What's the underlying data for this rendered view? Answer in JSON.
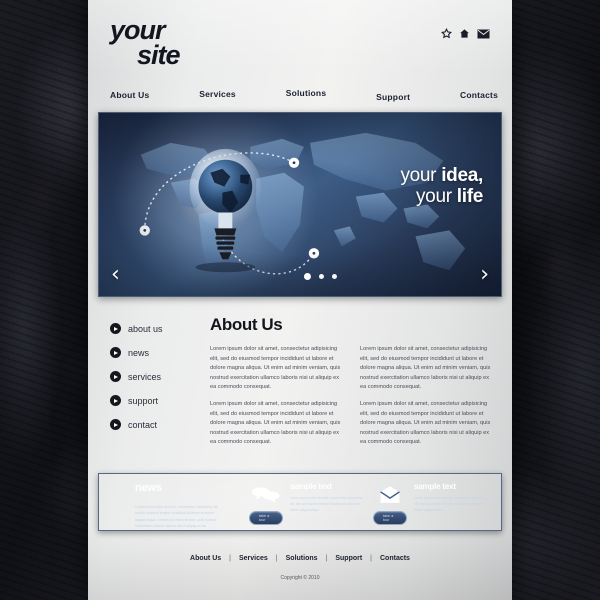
{
  "branding": {
    "logo_line1": "your",
    "logo_line2": "site"
  },
  "header": {
    "utility_icons": [
      {
        "name": "star-icon",
        "glyph": "star"
      },
      {
        "name": "home-icon",
        "glyph": "home"
      },
      {
        "name": "mail-icon",
        "glyph": "envelope"
      }
    ],
    "nav": [
      {
        "label": "About Us"
      },
      {
        "label": "Services"
      },
      {
        "label": "Solutions"
      },
      {
        "label": "Support"
      },
      {
        "label": "Contacts"
      }
    ]
  },
  "hero": {
    "headline_line1_thin": "your ",
    "headline_line1_bold": "idea,",
    "headline_line2_thin": "your ",
    "headline_line2_bold": "life",
    "prev_arrow": "‹",
    "next_arrow": "›",
    "slide_count": 3,
    "active_slide": 1
  },
  "sidebar": {
    "items": [
      {
        "label": "about us"
      },
      {
        "label": "news"
      },
      {
        "label": "services"
      },
      {
        "label": "support"
      },
      {
        "label": "contact"
      }
    ]
  },
  "about": {
    "title": "About Us",
    "columns": [
      {
        "paragraphs": [
          "Lorem ipsum dolor sit amet, consectetur adipisicing elit, sed do eiusmod tempor incididunt ut labore et dolore magna aliqua. Ut enim ad minim veniam, quis nostrud exercitation ullamco laboris nisi ut aliquip ex ea commodo consequat.",
          "Lorem ipsum dolor sit amet, consectetur adipisicing elit, sed do eiusmod tempor incididunt ut labore et dolore magna aliqua. Ut enim ad minim veniam, quis nostrud exercitation ullamco laboris nisi ut aliquip ex ea commodo consequat."
        ]
      },
      {
        "paragraphs": [
          "Lorem ipsum dolor sit amet, consectetur adipisicing elit, sed do eiusmod tempor incididunt ut labore et dolore magna aliqua. Ut enim ad minim veniam, quis nostrud exercitation ullamco laboris nisi ut aliquip ex ea commodo consequat.",
          "Lorem ipsum dolor sit amet, consectetur adipisicing elit, sed do eiusmod tempor incididunt ut labore et dolore magna aliqua. Ut enim ad minim veniam, quis nostrud exercitation ullamco laboris nisi ut aliquip ex ea commodo consequat."
        ]
      }
    ]
  },
  "news_band": {
    "title": "news",
    "intro": "Lorem ipsum dolor sit amet, consectetur adipisicing elit, sed do eiusmod tempor incididunt ut labore et dolore magna aliqua. Ut enim ad minim veniam, quis nostrud exercitation ullamco laboris nisi ut aliquip ex ea commodo consequat.",
    "blocks": [
      {
        "icon": "speech-bubbles-icon",
        "heading": "sample text",
        "body": "Lorem ipsum dolor sit amet, consectetur adipisicing elit, sed do eiusmod tempor incididunt ut labore et dolore magna aliqua.",
        "button_label": "take a tour"
      },
      {
        "icon": "envelope-icon",
        "heading": "sample text",
        "body": "Lorem ipsum dolor sit amet, consectetur adipisicing elit, sed do eiusmod tempor incididunt ut labore et dolore magna aliqua.",
        "button_label": "take a tour"
      }
    ]
  },
  "footer": {
    "nav": [
      {
        "label": "About Us"
      },
      {
        "label": "Services"
      },
      {
        "label": "Solutions"
      },
      {
        "label": "Support"
      },
      {
        "label": "Contacts"
      }
    ],
    "separator": "|",
    "copyright": "Copyright © 2010"
  },
  "colors": {
    "page_bg": "#eceded",
    "ink": "#14161f",
    "hero_blue": "#2c4164",
    "band_blue": "#3a5party",
    "band_border": "#56688a"
  }
}
